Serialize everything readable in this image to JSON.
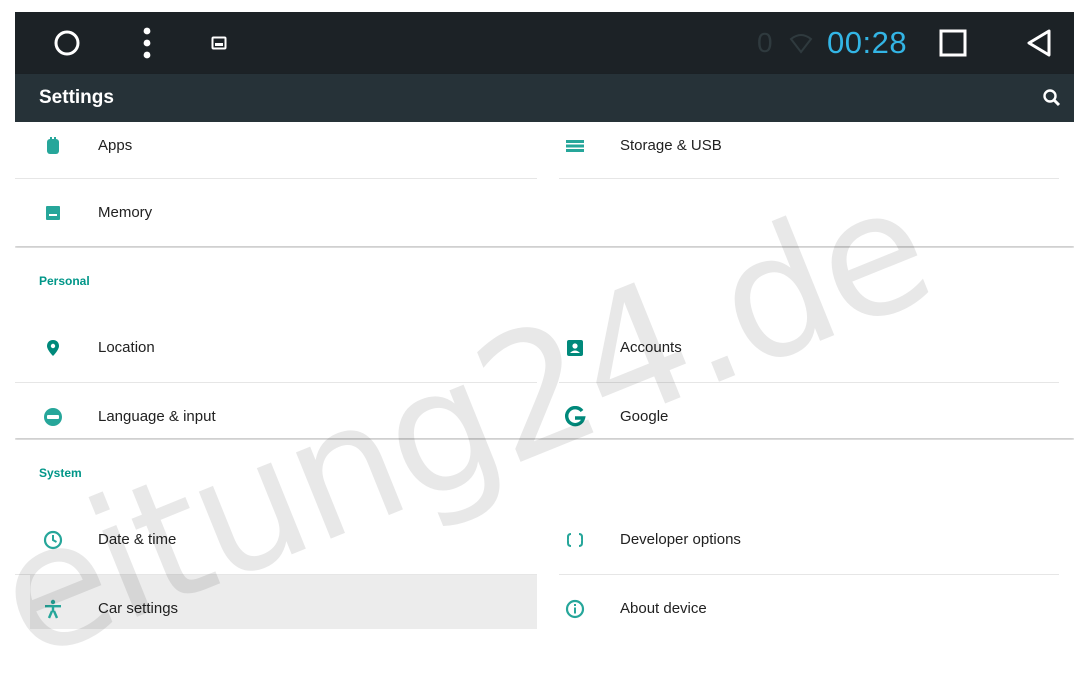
{
  "status_bar": {
    "time": "00:28",
    "faint_indicator": "0"
  },
  "action_bar": {
    "title": "Settings",
    "icons": [
      "search-icon"
    ]
  },
  "sections": {
    "device": {
      "items": [
        {
          "label": "Apps",
          "icon": "apps-icon"
        },
        {
          "label": "Storage & USB",
          "icon": "storage-icon"
        },
        {
          "label": "Memory",
          "icon": "memory-icon"
        }
      ]
    },
    "personal": {
      "header": "Personal",
      "items": [
        {
          "label": "Location",
          "icon": "location-icon"
        },
        {
          "label": "Accounts",
          "icon": "accounts-icon"
        },
        {
          "label": "Language & input",
          "icon": "language-icon"
        },
        {
          "label": "Google",
          "icon": "google-icon"
        }
      ]
    },
    "system": {
      "header": "System",
      "items": [
        {
          "label": "Date & time",
          "icon": "clock-icon"
        },
        {
          "label": "Developer options",
          "icon": "developer-braces-icon"
        },
        {
          "label": "Car settings",
          "icon": "accessibility-icon"
        },
        {
          "label": "About device",
          "icon": "info-icon"
        }
      ]
    }
  },
  "watermark": "eitung24.de",
  "colors": {
    "status_bar": "#1c2226",
    "action_bar": "#263238",
    "accent": "#009688",
    "clock": "#33b5e5"
  }
}
